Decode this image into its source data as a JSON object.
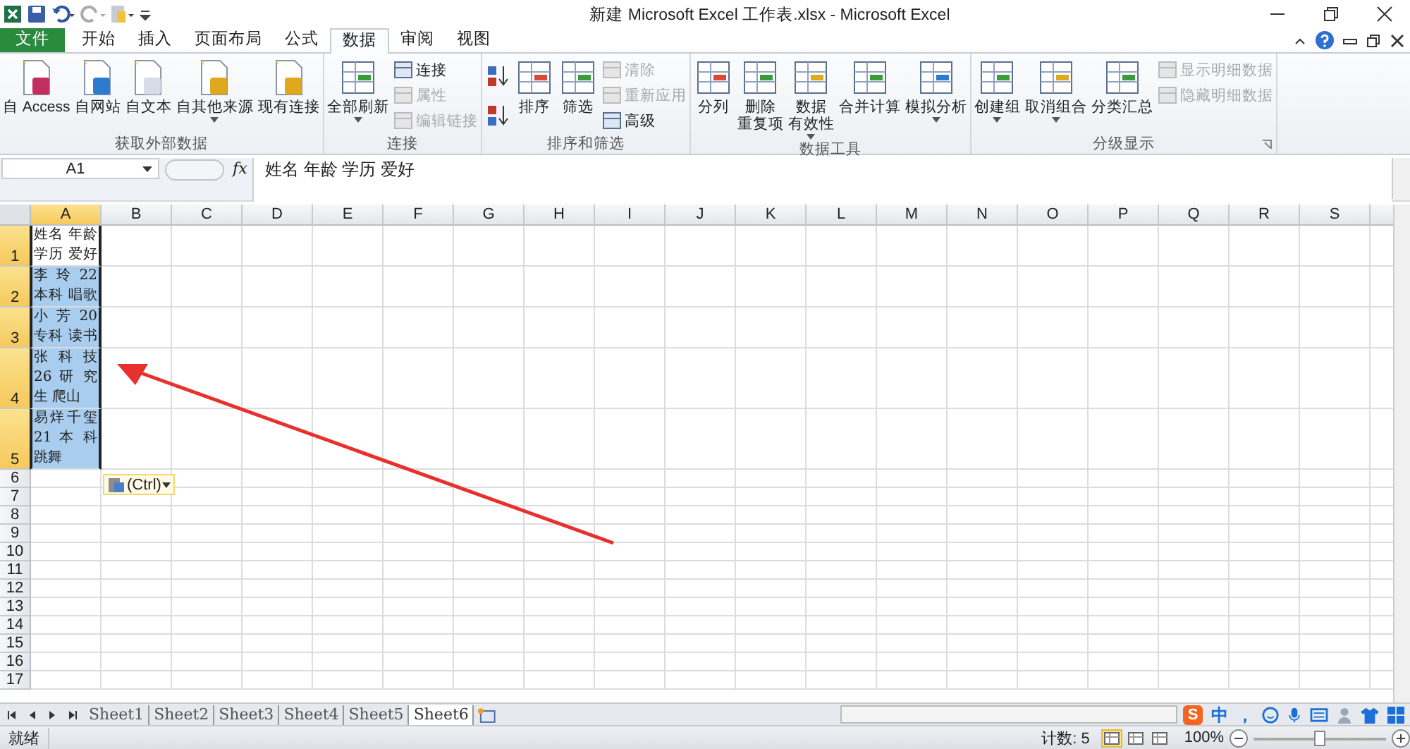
{
  "window": {
    "title": "新建 Microsoft Excel 工作表.xlsx - Microsoft Excel"
  },
  "ribbon_tabs": [
    {
      "label": "文件",
      "kind": "file",
      "selected": false
    },
    {
      "label": "开始",
      "kind": "tab",
      "selected": false
    },
    {
      "label": "插入",
      "kind": "tab",
      "selected": false
    },
    {
      "label": "页面布局",
      "kind": "tab",
      "selected": false
    },
    {
      "label": "公式",
      "kind": "tab",
      "selected": false
    },
    {
      "label": "数据",
      "kind": "tab",
      "selected": true
    },
    {
      "label": "审阅",
      "kind": "tab",
      "selected": false
    },
    {
      "label": "视图",
      "kind": "tab",
      "selected": false
    }
  ],
  "ribbon_groups": [
    {
      "title": "获取外部数据",
      "launcher": false,
      "items": [
        {
          "kind": "large",
          "lines": [
            "自 Access"
          ],
          "dropdown": false
        },
        {
          "kind": "large",
          "lines": [
            "自网站"
          ],
          "dropdown": false
        },
        {
          "kind": "large",
          "lines": [
            "自文本"
          ],
          "dropdown": false
        },
        {
          "kind": "large",
          "lines": [
            "自其他来源"
          ],
          "dropdown": true
        },
        {
          "kind": "large",
          "lines": [
            "现有连接"
          ],
          "dropdown": false
        }
      ]
    },
    {
      "title": "连接",
      "launcher": false,
      "items": [
        {
          "kind": "large",
          "lines": [
            "全部刷新"
          ],
          "dropdown": true
        },
        {
          "kind": "stack",
          "entries": [
            {
              "label": "连接",
              "disabled": false
            },
            {
              "label": "属性",
              "disabled": true
            },
            {
              "label": "编辑链接",
              "disabled": true
            }
          ]
        }
      ]
    },
    {
      "title": "排序和筛选",
      "launcher": false,
      "items": [
        {
          "kind": "sorticons"
        },
        {
          "kind": "large",
          "lines": [
            "排序"
          ],
          "dropdown": false
        },
        {
          "kind": "large",
          "lines": [
            "筛选"
          ],
          "dropdown": false
        },
        {
          "kind": "stack",
          "entries": [
            {
              "label": "清除",
              "disabled": true
            },
            {
              "label": "重新应用",
              "disabled": true
            },
            {
              "label": "高级",
              "disabled": false
            }
          ]
        }
      ]
    },
    {
      "title": "数据工具",
      "launcher": false,
      "items": [
        {
          "kind": "large",
          "lines": [
            "分列"
          ],
          "dropdown": false
        },
        {
          "kind": "large",
          "lines": [
            "删除",
            "重复项"
          ],
          "dropdown": false
        },
        {
          "kind": "large",
          "lines": [
            "数据",
            "有效性"
          ],
          "dropdown": true
        },
        {
          "kind": "large",
          "lines": [
            "合并计算"
          ],
          "dropdown": false
        },
        {
          "kind": "large",
          "lines": [
            "模拟分析"
          ],
          "dropdown": true
        }
      ]
    },
    {
      "title": "分级显示",
      "launcher": true,
      "items": [
        {
          "kind": "large",
          "lines": [
            "创建组"
          ],
          "dropdown": true
        },
        {
          "kind": "large",
          "lines": [
            "取消组合"
          ],
          "dropdown": true
        },
        {
          "kind": "large",
          "lines": [
            "分类汇总"
          ],
          "dropdown": false
        },
        {
          "kind": "stack",
          "entries": [
            {
              "label": "显示明细数据",
              "disabled": true
            },
            {
              "label": "隐藏明细数据",
              "disabled": true
            }
          ]
        }
      ]
    }
  ],
  "formula_bar": {
    "name_box": "A1",
    "fx": "fx",
    "formula": "姓名 年龄 学历 爱好"
  },
  "columns": [
    {
      "label": "A",
      "selected": true
    },
    {
      "label": "B",
      "selected": false
    },
    {
      "label": "C",
      "selected": false
    },
    {
      "label": "D",
      "selected": false
    },
    {
      "label": "E",
      "selected": false
    },
    {
      "label": "F",
      "selected": false
    },
    {
      "label": "G",
      "selected": false
    },
    {
      "label": "H",
      "selected": false
    },
    {
      "label": "I",
      "selected": false
    },
    {
      "label": "J",
      "selected": false
    },
    {
      "label": "K",
      "selected": false
    },
    {
      "label": "L",
      "selected": false
    },
    {
      "label": "M",
      "selected": false
    },
    {
      "label": "N",
      "selected": false
    },
    {
      "label": "O",
      "selected": false
    },
    {
      "label": "P",
      "selected": false
    },
    {
      "label": "Q",
      "selected": false
    },
    {
      "label": "R",
      "selected": false
    },
    {
      "label": "S",
      "selected": false
    }
  ],
  "rows": [
    {
      "label": "1",
      "selected": true,
      "active": true,
      "cell_lines": [
        "姓名 年龄",
        "学历 爱好"
      ]
    },
    {
      "label": "2",
      "selected": true,
      "active": false,
      "cell_lines": [
        "李 玲 22",
        "本科 唱歌"
      ]
    },
    {
      "label": "3",
      "selected": true,
      "active": false,
      "cell_lines": [
        "小 芳 20",
        "专科 读书"
      ]
    },
    {
      "label": "4",
      "selected": true,
      "active": false,
      "cell_lines": [
        "张 科 技",
        "26 研 究",
        "生 爬山"
      ]
    },
    {
      "label": "5",
      "selected": true,
      "active": false,
      "cell_lines": [
        "易烊千玺",
        "21 本 科",
        "跳舞"
      ]
    },
    {
      "label": "6",
      "selected": false,
      "active": false
    },
    {
      "label": "7",
      "selected": false,
      "active": false
    },
    {
      "label": "8",
      "selected": false,
      "active": false
    },
    {
      "label": "9",
      "selected": false,
      "active": false
    },
    {
      "label": "10",
      "selected": false,
      "active": false
    },
    {
      "label": "11",
      "selected": false,
      "active": false
    },
    {
      "label": "12",
      "selected": false,
      "active": false
    },
    {
      "label": "13",
      "selected": false,
      "active": false
    },
    {
      "label": "14",
      "selected": false,
      "active": false
    },
    {
      "label": "15",
      "selected": false,
      "active": false
    },
    {
      "label": "16",
      "selected": false,
      "active": false
    },
    {
      "label": "17",
      "selected": false,
      "active": false
    }
  ],
  "paste_options": {
    "label": "(Ctrl)"
  },
  "sheet_tabs": [
    {
      "label": "Sheet1",
      "selected": false
    },
    {
      "label": "Sheet2",
      "selected": false
    },
    {
      "label": "Sheet3",
      "selected": false
    },
    {
      "label": "Sheet4",
      "selected": false
    },
    {
      "label": "Sheet5",
      "selected": false
    },
    {
      "label": "Sheet6",
      "selected": true
    }
  ],
  "ime_toolbar": {
    "logo": "S",
    "mode": "中",
    "punct": "，"
  },
  "status_bar": {
    "status": "就绪",
    "count": "计数: 5",
    "views": [
      {
        "selected": true
      },
      {
        "selected": false
      },
      {
        "selected": false
      }
    ],
    "zoom": "100%",
    "zoom_slider": {
      "level": 0.5
    }
  }
}
